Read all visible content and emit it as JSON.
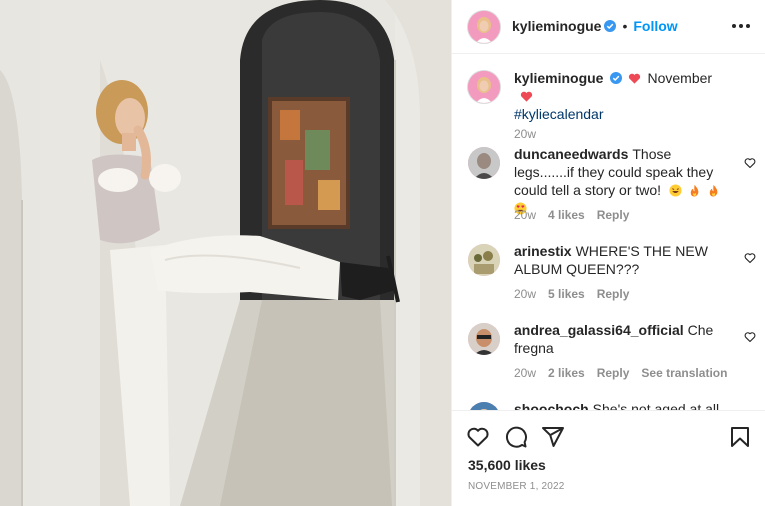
{
  "post": {
    "author": "kylieminogue",
    "follow_label": "Follow",
    "dot": "•",
    "image_alt": "Photo by kylieminogue: woman in white trousers and feathered top leaning in an arched hallway with one leg raised"
  },
  "caption": {
    "username": "kylieminogue",
    "text": "November",
    "hashtag": "#kyliecalendar",
    "age": "20w",
    "emoji": [
      "red-heart",
      "red-heart"
    ]
  },
  "comments": [
    {
      "username": "duncaneedwards",
      "text": "Those legs.......if they could speak they could tell a story or two!",
      "emoji": [
        "laughing-face",
        "fire",
        "fire",
        "heart-eyes-face"
      ],
      "age": "20w",
      "likes": "4 likes",
      "reply": "Reply"
    },
    {
      "username": "arinestix",
      "text": "WHERE'S THE NEW ALBUM QUEEN???",
      "age": "20w",
      "likes": "5 likes",
      "reply": "Reply"
    },
    {
      "username": "andrea_galassi64_official",
      "text": "Che fregna",
      "age": "20w",
      "likes": "2 likes",
      "reply": "Reply",
      "translate": "See translation"
    },
    {
      "username": "shoochoch",
      "text": "She's not aged at all"
    }
  ],
  "engagement": {
    "likes": "35,600 likes",
    "date": "November 1, 2022"
  },
  "icons": {
    "like": "heart-outline-icon",
    "comment": "comment-bubble-icon",
    "share": "paper-plane-icon",
    "save": "bookmark-icon",
    "more": "more-options-icon",
    "verified": "verified-badge-icon"
  },
  "colors": {
    "accent": "#0095f6",
    "verified": "#3897f0",
    "hashtag": "#00376b",
    "muted": "#8e8e8e",
    "text": "#262626",
    "heart_red": "#ed4956"
  }
}
